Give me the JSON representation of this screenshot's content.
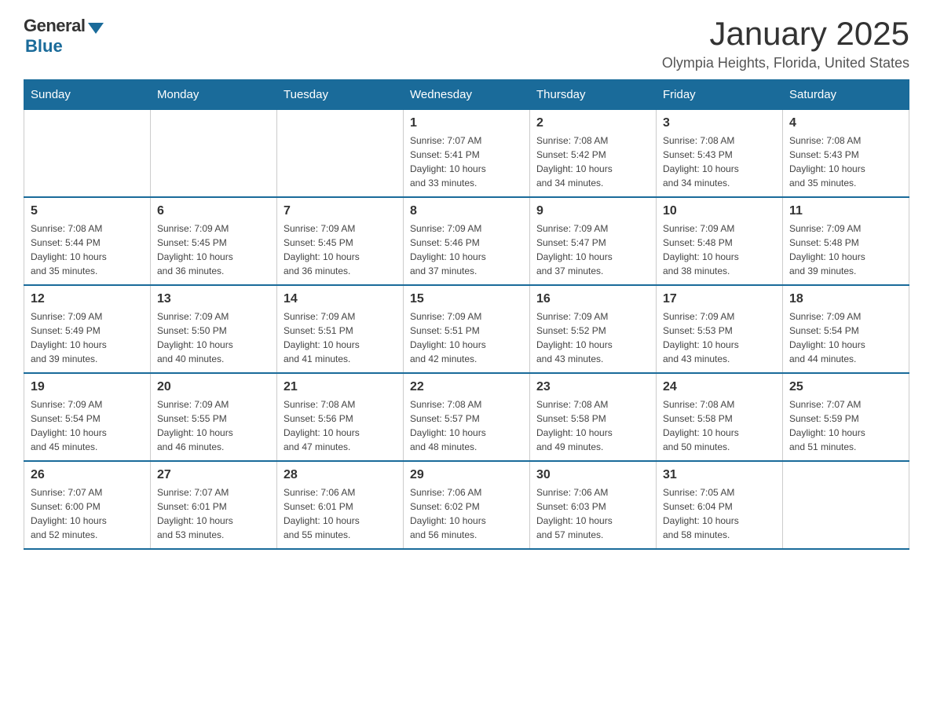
{
  "logo": {
    "general_text": "General",
    "blue_text": "Blue"
  },
  "title": "January 2025",
  "location": "Olympia Heights, Florida, United States",
  "days_of_week": [
    "Sunday",
    "Monday",
    "Tuesday",
    "Wednesday",
    "Thursday",
    "Friday",
    "Saturday"
  ],
  "weeks": [
    [
      {
        "day": "",
        "info": ""
      },
      {
        "day": "",
        "info": ""
      },
      {
        "day": "",
        "info": ""
      },
      {
        "day": "1",
        "info": "Sunrise: 7:07 AM\nSunset: 5:41 PM\nDaylight: 10 hours\nand 33 minutes."
      },
      {
        "day": "2",
        "info": "Sunrise: 7:08 AM\nSunset: 5:42 PM\nDaylight: 10 hours\nand 34 minutes."
      },
      {
        "day": "3",
        "info": "Sunrise: 7:08 AM\nSunset: 5:43 PM\nDaylight: 10 hours\nand 34 minutes."
      },
      {
        "day": "4",
        "info": "Sunrise: 7:08 AM\nSunset: 5:43 PM\nDaylight: 10 hours\nand 35 minutes."
      }
    ],
    [
      {
        "day": "5",
        "info": "Sunrise: 7:08 AM\nSunset: 5:44 PM\nDaylight: 10 hours\nand 35 minutes."
      },
      {
        "day": "6",
        "info": "Sunrise: 7:09 AM\nSunset: 5:45 PM\nDaylight: 10 hours\nand 36 minutes."
      },
      {
        "day": "7",
        "info": "Sunrise: 7:09 AM\nSunset: 5:45 PM\nDaylight: 10 hours\nand 36 minutes."
      },
      {
        "day": "8",
        "info": "Sunrise: 7:09 AM\nSunset: 5:46 PM\nDaylight: 10 hours\nand 37 minutes."
      },
      {
        "day": "9",
        "info": "Sunrise: 7:09 AM\nSunset: 5:47 PM\nDaylight: 10 hours\nand 37 minutes."
      },
      {
        "day": "10",
        "info": "Sunrise: 7:09 AM\nSunset: 5:48 PM\nDaylight: 10 hours\nand 38 minutes."
      },
      {
        "day": "11",
        "info": "Sunrise: 7:09 AM\nSunset: 5:48 PM\nDaylight: 10 hours\nand 39 minutes."
      }
    ],
    [
      {
        "day": "12",
        "info": "Sunrise: 7:09 AM\nSunset: 5:49 PM\nDaylight: 10 hours\nand 39 minutes."
      },
      {
        "day": "13",
        "info": "Sunrise: 7:09 AM\nSunset: 5:50 PM\nDaylight: 10 hours\nand 40 minutes."
      },
      {
        "day": "14",
        "info": "Sunrise: 7:09 AM\nSunset: 5:51 PM\nDaylight: 10 hours\nand 41 minutes."
      },
      {
        "day": "15",
        "info": "Sunrise: 7:09 AM\nSunset: 5:51 PM\nDaylight: 10 hours\nand 42 minutes."
      },
      {
        "day": "16",
        "info": "Sunrise: 7:09 AM\nSunset: 5:52 PM\nDaylight: 10 hours\nand 43 minutes."
      },
      {
        "day": "17",
        "info": "Sunrise: 7:09 AM\nSunset: 5:53 PM\nDaylight: 10 hours\nand 43 minutes."
      },
      {
        "day": "18",
        "info": "Sunrise: 7:09 AM\nSunset: 5:54 PM\nDaylight: 10 hours\nand 44 minutes."
      }
    ],
    [
      {
        "day": "19",
        "info": "Sunrise: 7:09 AM\nSunset: 5:54 PM\nDaylight: 10 hours\nand 45 minutes."
      },
      {
        "day": "20",
        "info": "Sunrise: 7:09 AM\nSunset: 5:55 PM\nDaylight: 10 hours\nand 46 minutes."
      },
      {
        "day": "21",
        "info": "Sunrise: 7:08 AM\nSunset: 5:56 PM\nDaylight: 10 hours\nand 47 minutes."
      },
      {
        "day": "22",
        "info": "Sunrise: 7:08 AM\nSunset: 5:57 PM\nDaylight: 10 hours\nand 48 minutes."
      },
      {
        "day": "23",
        "info": "Sunrise: 7:08 AM\nSunset: 5:58 PM\nDaylight: 10 hours\nand 49 minutes."
      },
      {
        "day": "24",
        "info": "Sunrise: 7:08 AM\nSunset: 5:58 PM\nDaylight: 10 hours\nand 50 minutes."
      },
      {
        "day": "25",
        "info": "Sunrise: 7:07 AM\nSunset: 5:59 PM\nDaylight: 10 hours\nand 51 minutes."
      }
    ],
    [
      {
        "day": "26",
        "info": "Sunrise: 7:07 AM\nSunset: 6:00 PM\nDaylight: 10 hours\nand 52 minutes."
      },
      {
        "day": "27",
        "info": "Sunrise: 7:07 AM\nSunset: 6:01 PM\nDaylight: 10 hours\nand 53 minutes."
      },
      {
        "day": "28",
        "info": "Sunrise: 7:06 AM\nSunset: 6:01 PM\nDaylight: 10 hours\nand 55 minutes."
      },
      {
        "day": "29",
        "info": "Sunrise: 7:06 AM\nSunset: 6:02 PM\nDaylight: 10 hours\nand 56 minutes."
      },
      {
        "day": "30",
        "info": "Sunrise: 7:06 AM\nSunset: 6:03 PM\nDaylight: 10 hours\nand 57 minutes."
      },
      {
        "day": "31",
        "info": "Sunrise: 7:05 AM\nSunset: 6:04 PM\nDaylight: 10 hours\nand 58 minutes."
      },
      {
        "day": "",
        "info": ""
      }
    ]
  ]
}
